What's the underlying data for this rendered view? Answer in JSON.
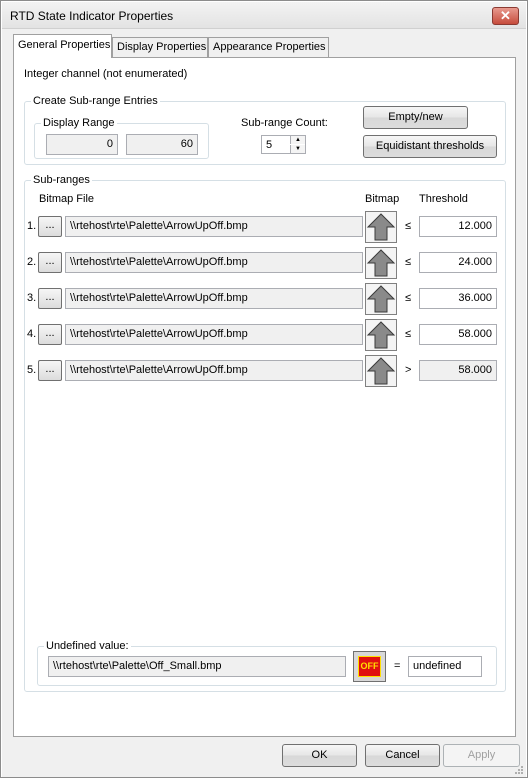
{
  "window": {
    "title": "RTD State Indicator Properties",
    "close_glyph": "✕"
  },
  "tabs": [
    {
      "label": "General Properties",
      "active": true
    },
    {
      "label": "Display Properties",
      "active": false
    },
    {
      "label": "Appearance Properties",
      "active": false
    }
  ],
  "channel_type": "Integer channel (not enumerated)",
  "create_group": {
    "label": "Create Sub-range Entries",
    "display_range_label": "Display Range",
    "range_min": "0",
    "range_max": "60",
    "count_label": "Sub-range Count:",
    "count_value": "5",
    "empty_new_label": "Empty/new",
    "equidistant_label": "Equidistant thresholds"
  },
  "subranges": {
    "label": "Sub-ranges",
    "col_bitmap_file": "Bitmap File",
    "col_bitmap": "Bitmap",
    "col_threshold": "Threshold",
    "browse_label": "...",
    "rows": [
      {
        "index": "1.",
        "file": "\\\\rtehost\\rte\\Palette\\ArrowUpOff.bmp",
        "op": "≤",
        "threshold": "12.000",
        "editable": true
      },
      {
        "index": "2.",
        "file": "\\\\rtehost\\rte\\Palette\\ArrowUpOff.bmp",
        "op": "≤",
        "threshold": "24.000",
        "editable": true
      },
      {
        "index": "3.",
        "file": "\\\\rtehost\\rte\\Palette\\ArrowUpOff.bmp",
        "op": "≤",
        "threshold": "36.000",
        "editable": true
      },
      {
        "index": "4.",
        "file": "\\\\rtehost\\rte\\Palette\\ArrowUpOff.bmp",
        "op": "≤",
        "threshold": "58.000",
        "editable": true
      },
      {
        "index": "5.",
        "file": "\\\\rtehost\\rte\\Palette\\ArrowUpOff.bmp",
        "op": ">",
        "threshold": "58.000",
        "editable": false
      }
    ]
  },
  "undefined_group": {
    "label": "Undefined value:",
    "file": "\\\\rtehost\\rte\\Palette\\Off_Small.bmp",
    "icon_text": "OFF",
    "equals": "=",
    "value": "undefined"
  },
  "buttons": {
    "ok": "OK",
    "cancel": "Cancel",
    "apply": "Apply"
  },
  "colors": {
    "off_red": "#e01010",
    "off_yellow": "#ffe000",
    "arrow_gray": "#8a8a8a"
  },
  "icons": [
    "close-icon",
    "arrow-up-icon",
    "off-icon",
    "spin-up-icon",
    "spin-down-icon",
    "size-grip-icon"
  ]
}
